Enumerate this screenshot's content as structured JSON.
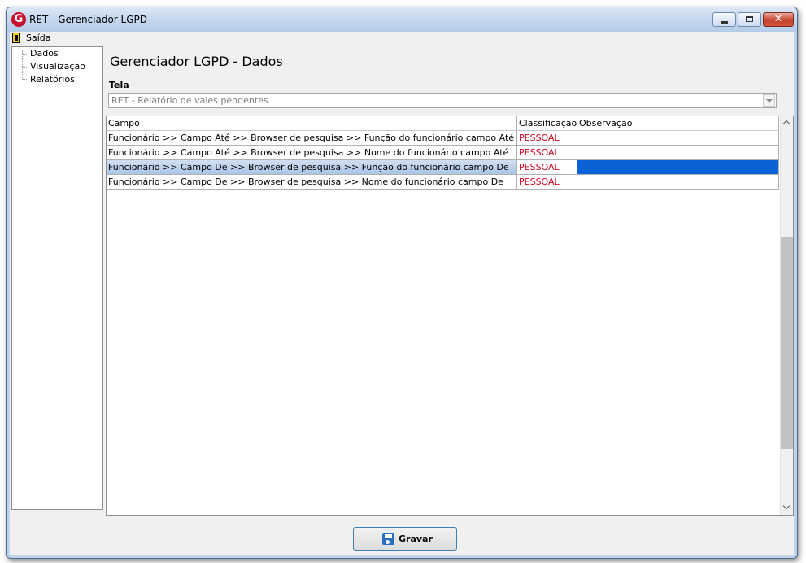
{
  "window": {
    "title": "RET - Gerenciador LGPD",
    "icon": "app-logo-icon",
    "controls": [
      "minimize-icon",
      "maximize-icon",
      "close-icon"
    ]
  },
  "menubar": {
    "exit_label": "Saída",
    "exit_icon": "exit-door-icon"
  },
  "sidebar": {
    "items": [
      {
        "label": "Dados"
      },
      {
        "label": "Visualização"
      },
      {
        "label": "Relatórios"
      }
    ]
  },
  "main": {
    "title": "Gerenciador LGPD - Dados",
    "screen_label": "Tela",
    "screen_value": "RET - Relatório de vales pendentes"
  },
  "grid": {
    "columns": [
      "Campo",
      "Classificação",
      "Observação"
    ],
    "rows": [
      {
        "campo": "Funcionário >> Campo Até >> Browser de pesquisa >> Função do funcionário campo Até",
        "classificacao": "PESSOAL",
        "observacao": "",
        "selected": false
      },
      {
        "campo": "Funcionário >> Campo Até >> Browser de pesquisa >> Nome do funcionário campo Até",
        "classificacao": "PESSOAL",
        "observacao": "",
        "selected": false
      },
      {
        "campo": "Funcionário >> Campo De >> Browser de pesquisa >> Função do funcionário campo De",
        "classificacao": "PESSOAL",
        "observacao": "",
        "selected": true
      },
      {
        "campo": "Funcionário >> Campo De >> Browser de pesquisa >> Nome do funcionário campo De",
        "classificacao": "PESSOAL",
        "observacao": "",
        "selected": false
      }
    ]
  },
  "footer": {
    "save_label": "Gravar",
    "save_icon": "floppy-disk-icon"
  },
  "colors": {
    "classification_text": "#d3001e",
    "selection_highlight": "#0a62d6",
    "title_bar": "#c4d7ee"
  }
}
